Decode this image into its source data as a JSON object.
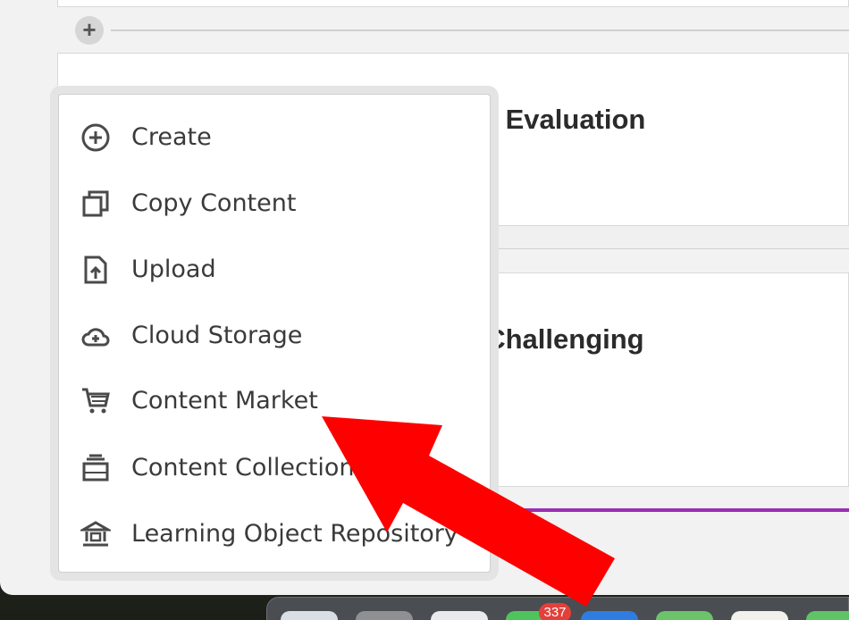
{
  "cards": [
    {
      "title": "or Evaluation"
    },
    {
      "title": "l Challenging"
    }
  ],
  "add_button": {
    "label": "+"
  },
  "menu": {
    "items": [
      {
        "label": "Create",
        "icon": "plus-circle-icon"
      },
      {
        "label": "Copy Content",
        "icon": "copy-icon"
      },
      {
        "label": "Upload",
        "icon": "upload-file-icon"
      },
      {
        "label": "Cloud Storage",
        "icon": "cloud-plus-icon"
      },
      {
        "label": "Content Market",
        "icon": "cart-icon"
      },
      {
        "label": "Content Collection",
        "icon": "collection-icon"
      },
      {
        "label": "Learning Object Repository",
        "icon": "repository-icon"
      }
    ]
  },
  "dock": {
    "badge_count": "337"
  },
  "colors": {
    "accent_purple": "#9b2fb3",
    "annotation_red": "#ff0000",
    "badge_red": "#e2403a"
  }
}
